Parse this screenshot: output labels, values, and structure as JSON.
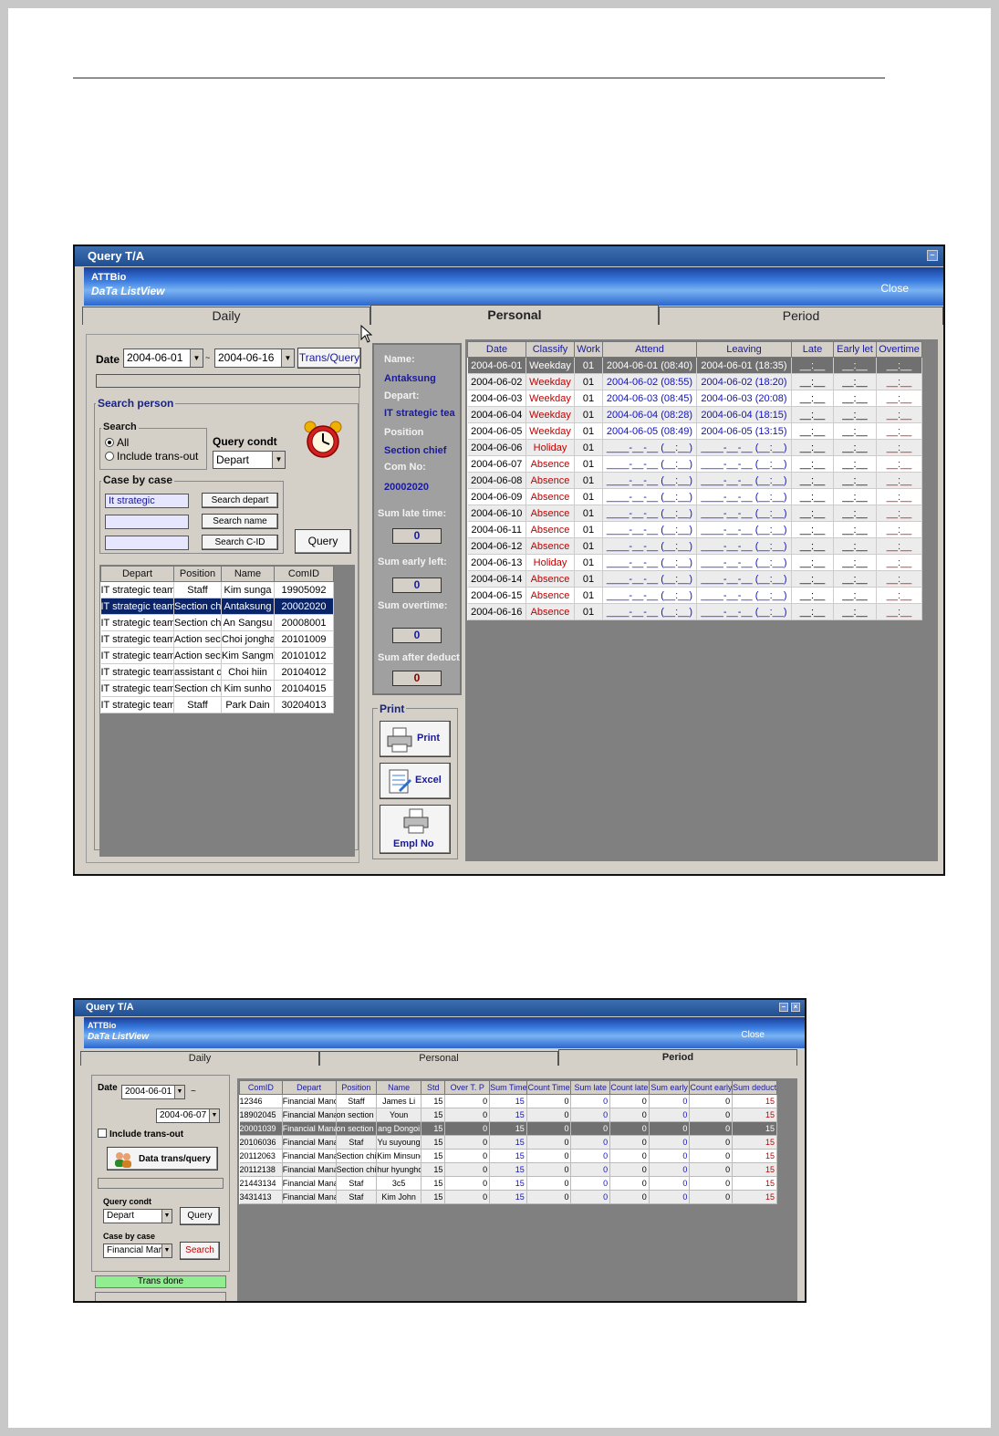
{
  "win1": {
    "title": "Query T/A",
    "banner_line1": "ATTBio",
    "banner_line2": "DaTa ListView",
    "close_label": "Close",
    "tabs": [
      "Daily",
      "Personal",
      "Period"
    ],
    "date_label": "Date",
    "date_from": "2004-06-01",
    "date_sep": "~",
    "date_to": "2004-06-16",
    "trans_query_label": "Trans/Query",
    "search_person_title": "Search person",
    "search_group_title": "Search",
    "radio_all": "All",
    "radio_include": "Include trans-out",
    "query_condt_label": "Query condt",
    "query_condt_value": "Depart",
    "case_title": "Case by case",
    "case_input1": "It strategic",
    "search_depart_label": "Search depart",
    "search_name_label": "Search name",
    "search_cid_label": "Search C-ID",
    "query_label": "Query",
    "person_columns": [
      "Depart",
      "Position",
      "Name",
      "ComID"
    ],
    "person_rows": [
      [
        "IT strategic team",
        "Staff",
        "Kim sunga",
        "19905092"
      ],
      [
        "IT strategic team",
        "Section chi",
        "Antaksung",
        "20002020"
      ],
      [
        "IT strategic team",
        "Section chi",
        "An Sangsu",
        "20008001"
      ],
      [
        "IT strategic team",
        "Action secti",
        "Choi jongha",
        "20101009"
      ],
      [
        "IT strategic team",
        "Action secti",
        "Kim Sangmi",
        "20101012"
      ],
      [
        "IT strategic team",
        "assistant di",
        "Choi hiin",
        "20104012"
      ],
      [
        "IT strategic team",
        "Section chi",
        "Kim sunho",
        "20104015"
      ],
      [
        "IT strategic team",
        "Staff",
        "Park Dain",
        "30204013"
      ]
    ],
    "info": {
      "name_label": "Name:",
      "name_value": "Antaksung",
      "depart_label": "Depart:",
      "depart_value": "IT strategic tea",
      "position_label": "Position",
      "position_value": "Section chief",
      "comno_label": "Com No:",
      "comno_value": "20002020",
      "sum_late_label": "Sum late time:",
      "sum_late_value": "0",
      "sum_early_label": "Sum early left:",
      "sum_early_value": "0",
      "sum_over_label": "Sum overtime:",
      "sum_over_value": "0",
      "sum_after_label": "Sum after deduct",
      "sum_after_value": "0"
    },
    "print_title": "Print",
    "print_label": "Print",
    "excel_label": "Excel",
    "emplno_label": "Empl No",
    "att_columns": [
      "Date",
      "Classify",
      "Work",
      "Attend",
      "Leaving",
      "Late",
      "Early let",
      "Overtime"
    ],
    "att_rows": [
      [
        "2004-06-01",
        "Weekday",
        "01",
        "2004-06-01 (08:40)",
        "2004-06-01 (18:35)",
        "__:__",
        "__:__",
        "__:__"
      ],
      [
        "2004-06-02",
        "Weekday",
        "01",
        "2004-06-02 (08:55)",
        "2004-06-02 (18:20)",
        "__:__",
        "__:__",
        "__:__"
      ],
      [
        "2004-06-03",
        "Weekday",
        "01",
        "2004-06-03 (08:45)",
        "2004-06-03 (20:08)",
        "__:__",
        "__:__",
        "__:__"
      ],
      [
        "2004-06-04",
        "Weekday",
        "01",
        "2004-06-04 (08:28)",
        "2004-06-04 (18:15)",
        "__:__",
        "__:__",
        "__:__"
      ],
      [
        "2004-06-05",
        "Weekday",
        "01",
        "2004-06-05 (08:49)",
        "2004-06-05 (13:15)",
        "__:__",
        "__:__",
        "__:__"
      ],
      [
        "2004-06-06",
        "Holiday",
        "01",
        "____-__-__ (__:__)",
        "____-__-__ (__:__)",
        "__:__",
        "__:__",
        "__:__"
      ],
      [
        "2004-06-07",
        "Absence",
        "01",
        "____-__-__ (__:__)",
        "____-__-__ (__:__)",
        "__:__",
        "__:__",
        "__:__"
      ],
      [
        "2004-06-08",
        "Absence",
        "01",
        "____-__-__ (__:__)",
        "____-__-__ (__:__)",
        "__:__",
        "__:__",
        "__:__"
      ],
      [
        "2004-06-09",
        "Absence",
        "01",
        "____-__-__ (__:__)",
        "____-__-__ (__:__)",
        "__:__",
        "__:__",
        "__:__"
      ],
      [
        "2004-06-10",
        "Absence",
        "01",
        "____-__-__ (__:__)",
        "____-__-__ (__:__)",
        "__:__",
        "__:__",
        "__:__"
      ],
      [
        "2004-06-11",
        "Absence",
        "01",
        "____-__-__ (__:__)",
        "____-__-__ (__:__)",
        "__:__",
        "__:__",
        "__:__"
      ],
      [
        "2004-06-12",
        "Absence",
        "01",
        "____-__-__ (__:__)",
        "____-__-__ (__:__)",
        "__:__",
        "__:__",
        "__:__"
      ],
      [
        "2004-06-13",
        "Holiday",
        "01",
        "____-__-__ (__:__)",
        "____-__-__ (__:__)",
        "__:__",
        "__:__",
        "__:__"
      ],
      [
        "2004-06-14",
        "Absence",
        "01",
        "____-__-__ (__:__)",
        "____-__-__ (__:__)",
        "__:__",
        "__:__",
        "__:__"
      ],
      [
        "2004-06-15",
        "Absence",
        "01",
        "____-__-__ (__:__)",
        "____-__-__ (__:__)",
        "__:__",
        "__:__",
        "__:__"
      ],
      [
        "2004-06-16",
        "Absence",
        "01",
        "____-__-__ (__:__)",
        "____-__-__ (__:__)",
        "__:__",
        "__:__",
        "__:__"
      ]
    ]
  },
  "win2": {
    "title": "Query T/A",
    "banner_line1": "ATTBio",
    "banner_line2": "DaTa ListView",
    "close_label": "Close",
    "tabs": [
      "Daily",
      "Personal",
      "Period"
    ],
    "date_label": "Date",
    "date_from": "2004-06-01",
    "date_sep": "~",
    "date_to": "2004-06-07",
    "include_label": "Include trans-out",
    "data_trans_label": "Data trans/query",
    "query_condt_label": "Query condt",
    "query_condt_value": "Depart",
    "query_label": "Query",
    "case_label": "Case by case",
    "case_value": "Financial Mar",
    "search_label": "Search",
    "status_text": "Trans done",
    "columns": [
      "ComID",
      "Depart",
      "Position",
      "Name",
      "Std",
      "Over T. P",
      "Sum Time",
      "Count Time",
      "Sum late",
      "Count late",
      "Sum early",
      "Count early",
      "Sum deduct"
    ],
    "rows": [
      [
        "12346",
        "Financial Manc",
        "Staff",
        "James Li",
        "15",
        "0",
        "15",
        "0",
        "0",
        "0",
        "0",
        "0",
        "15"
      ],
      [
        "18902045",
        "Financial Mana",
        "on section c",
        "Youn",
        "15",
        "0",
        "15",
        "0",
        "0",
        "0",
        "0",
        "0",
        "15"
      ],
      [
        "20001039",
        "Financial Mana",
        "on section c",
        "ang Dongoi",
        "15",
        "0",
        "15",
        "0",
        "0",
        "0",
        "0",
        "0",
        "15"
      ],
      [
        "20106036",
        "Financial Mana",
        "Staf",
        "Yu suyoung",
        "15",
        "0",
        "15",
        "0",
        "0",
        "0",
        "0",
        "0",
        "15"
      ],
      [
        "20112063",
        "Financial Mana",
        "Section chie",
        "Kim Minsung",
        "15",
        "0",
        "15",
        "0",
        "0",
        "0",
        "0",
        "0",
        "15"
      ],
      [
        "20112138",
        "Financial Mana",
        "Section chie",
        "hur hyungho",
        "15",
        "0",
        "15",
        "0",
        "0",
        "0",
        "0",
        "0",
        "15"
      ],
      [
        "21443134",
        "Financial Mana",
        "Staf",
        "3c5",
        "15",
        "0",
        "15",
        "0",
        "0",
        "0",
        "0",
        "0",
        "15"
      ],
      [
        "3431413",
        "Financial Mana",
        "Staf",
        "Kim John",
        "15",
        "0",
        "15",
        "0",
        "0",
        "0",
        "0",
        "0",
        "15"
      ]
    ]
  },
  "colors": {
    "title_bar": "#1f4f93",
    "banner": "#3a7ce0",
    "holiday_red": "#c00000",
    "link_blue": "#1010d0",
    "status_green": "#90ee90"
  }
}
